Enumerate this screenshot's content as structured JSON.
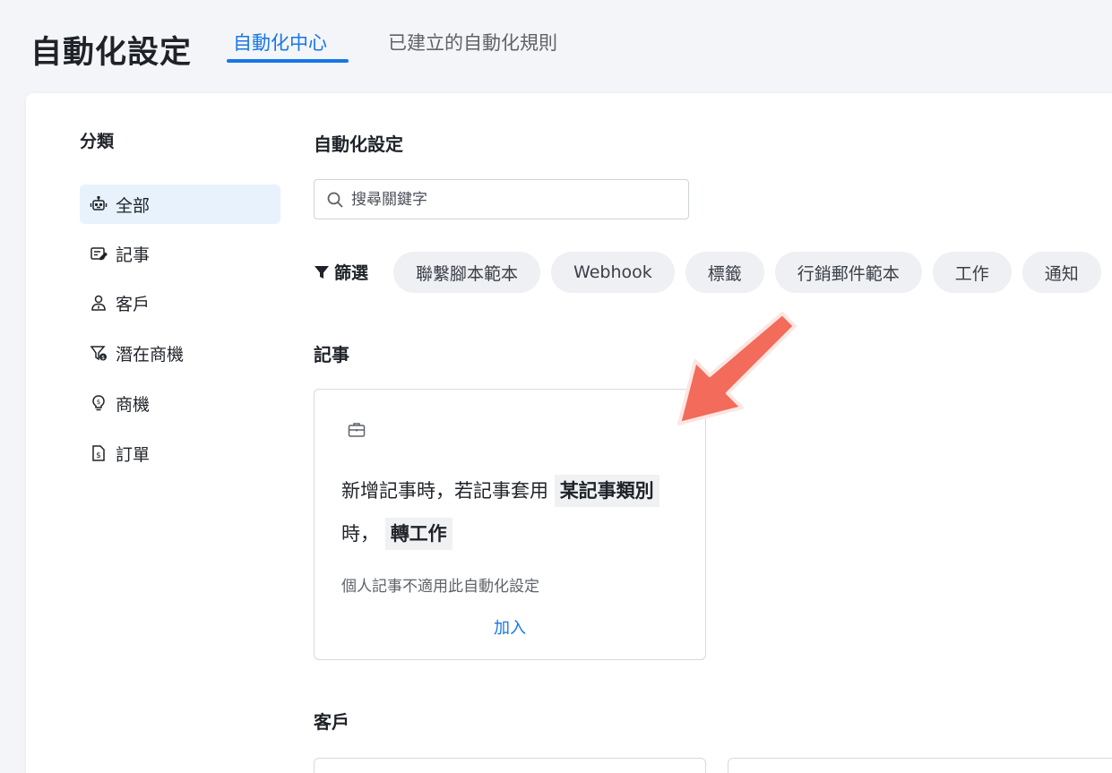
{
  "header": {
    "title": "自動化設定",
    "tabs": [
      {
        "label": "自動化中心",
        "active": true
      },
      {
        "label": "已建立的自動化規則",
        "active": false
      }
    ]
  },
  "sidebar": {
    "heading": "分類",
    "items": [
      {
        "label": "全部",
        "icon": "robot-icon",
        "active": true
      },
      {
        "label": "記事",
        "icon": "note-edit-icon",
        "active": false
      },
      {
        "label": "客戶",
        "icon": "customer-icon",
        "active": false
      },
      {
        "label": "潛在商機",
        "icon": "funnel-dollar-icon",
        "active": false
      },
      {
        "label": "商機",
        "icon": "lightbulb-dollar-icon",
        "active": false
      },
      {
        "label": "訂單",
        "icon": "order-document-icon",
        "active": false
      }
    ]
  },
  "main": {
    "heading": "自動化設定",
    "search": {
      "placeholder": "搜尋關鍵字",
      "value": ""
    },
    "filter": {
      "label": "篩選",
      "chips": [
        "聯繫腳本範本",
        "Webhook",
        "標籤",
        "行銷郵件範本",
        "工作",
        "通知"
      ]
    },
    "sections": [
      {
        "title": "記事",
        "cards": [
          {
            "icon": "briefcase-icon",
            "text_prefix": "新增記事時，若記事套用",
            "highlight_1": "某記事類別",
            "text_middle": "時，",
            "highlight_2": "轉工作",
            "note": "個人記事不適用此自動化設定",
            "action": "加入"
          }
        ]
      },
      {
        "title": "客戶"
      }
    ]
  },
  "colors": {
    "accent": "#1677e6",
    "active_bg": "#e8f2fd",
    "chip_bg": "#eef0f3",
    "page_bg": "#f4f5f8",
    "arrow": "#f26b5b"
  }
}
